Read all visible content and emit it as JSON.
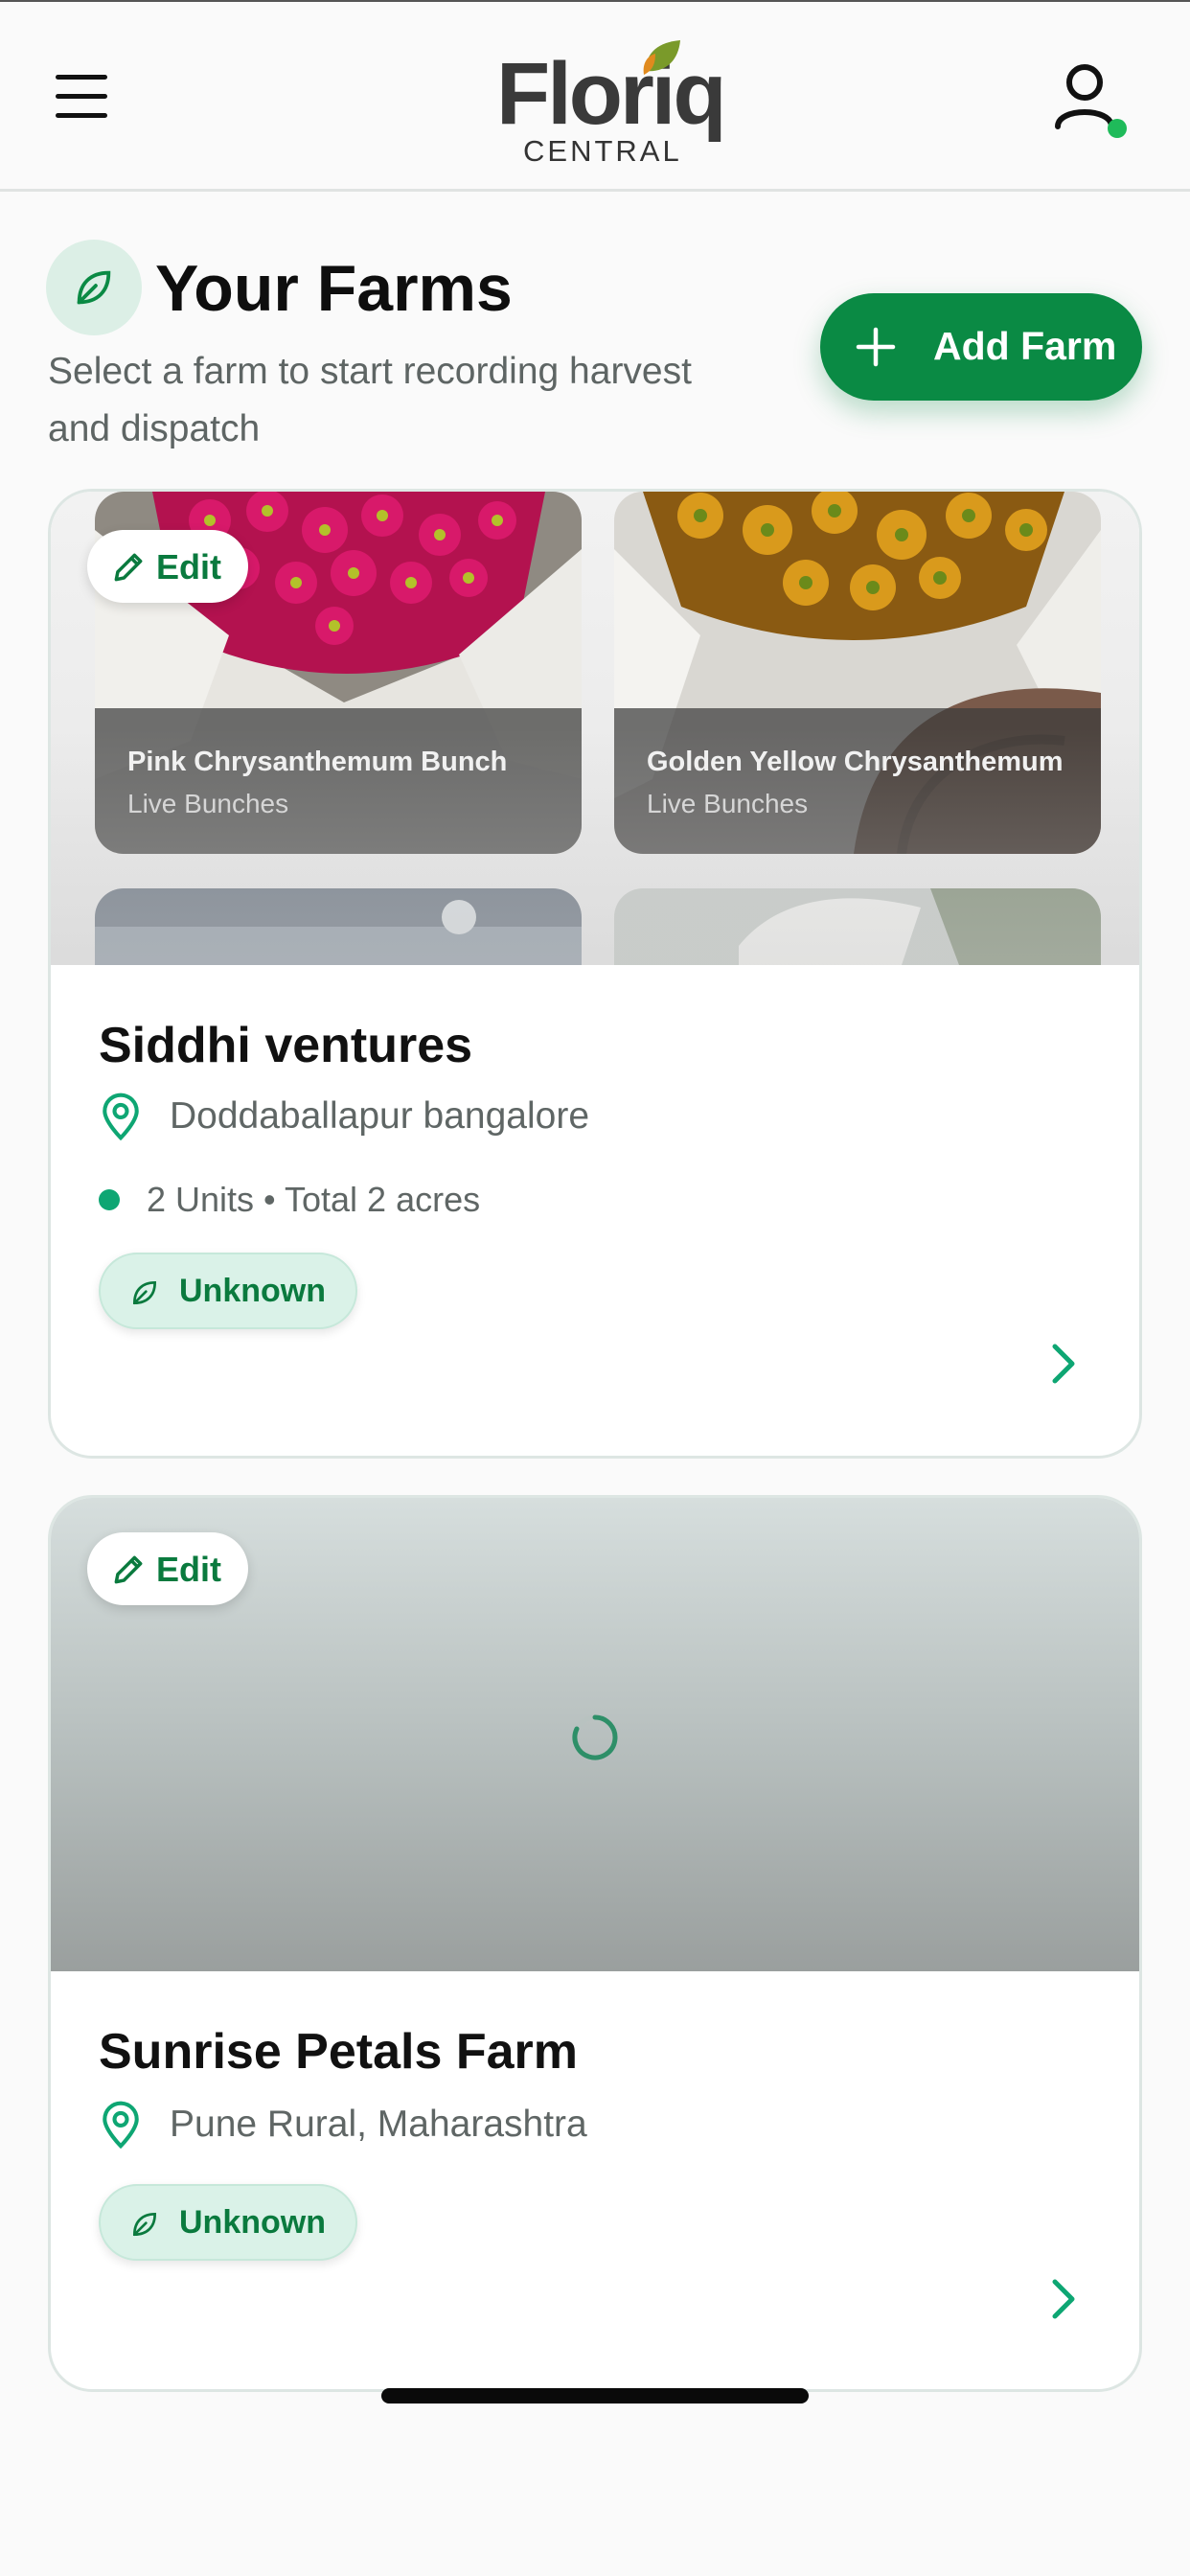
{
  "header": {
    "brand_name": "Floriq",
    "brand_sub": "CENTRAL",
    "menu_icon": "hamburger-menu-icon",
    "profile_icon": "user-icon",
    "online_color": "#1fbb5a"
  },
  "page": {
    "title": "Your Farms",
    "subtitle": "Select a farm to start recording harvest and dispatch",
    "add_button_label": "Add Farm",
    "accent_color": "#0a8a44"
  },
  "farms": [
    {
      "name": "Siddhi ventures",
      "location": "Doddaballapur bangalore",
      "units_summary": "2 Units • Total 2 acres",
      "status": "Unknown",
      "edit_label": "Edit",
      "gallery": [
        {
          "name": "Pink Chrysanthemum Bunch",
          "type": "Live Bunches"
        },
        {
          "name": "Golden Yellow Chrysanthemum",
          "type": "Live Bunches"
        }
      ]
    },
    {
      "name": "Sunrise Petals Farm",
      "location": "Pune Rural, Maharashtra",
      "status": "Unknown",
      "edit_label": "Edit"
    }
  ]
}
